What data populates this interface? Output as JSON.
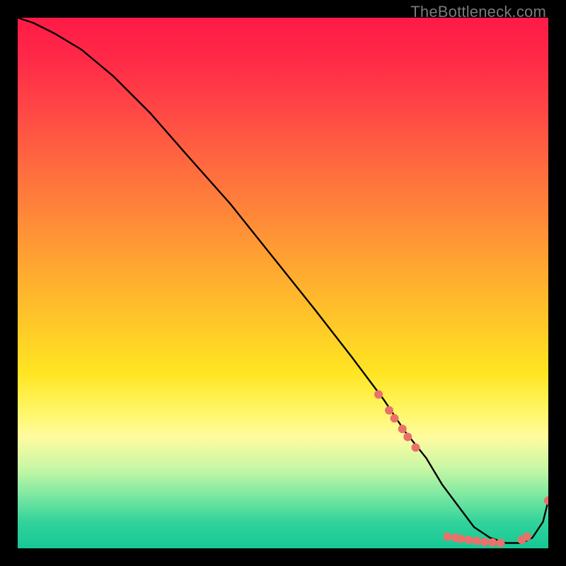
{
  "watermark": "TheBottleneck.com",
  "chart_data": {
    "type": "line",
    "title": "",
    "xlabel": "",
    "ylabel": "",
    "xlim": [
      0,
      100
    ],
    "ylim": [
      0,
      100
    ],
    "grid": false,
    "series": [
      {
        "name": "curve",
        "color": "#000000",
        "x": [
          0,
          3,
          7,
          12,
          18,
          25,
          32,
          40,
          48,
          56,
          63,
          69,
          73,
          77,
          80,
          83,
          86,
          89,
          92,
          95,
          97,
          99,
          100
        ],
        "y": [
          100,
          99,
          97,
          94,
          89,
          82,
          74,
          65,
          55,
          45,
          36,
          28,
          22,
          17,
          12,
          8,
          4,
          2,
          1,
          1,
          2,
          5,
          9
        ]
      }
    ],
    "markers": [
      {
        "name": "dots",
        "color": "#e9716b",
        "radius": 6,
        "points": [
          {
            "x": 68,
            "y": 29
          },
          {
            "x": 70,
            "y": 26
          },
          {
            "x": 71,
            "y": 24.5
          },
          {
            "x": 72.5,
            "y": 22.5
          },
          {
            "x": 73.5,
            "y": 21
          },
          {
            "x": 75,
            "y": 19
          },
          {
            "x": 81,
            "y": 2.2
          },
          {
            "x": 82.5,
            "y": 2.0
          },
          {
            "x": 83.5,
            "y": 1.8
          },
          {
            "x": 85,
            "y": 1.6
          },
          {
            "x": 86.5,
            "y": 1.4
          },
          {
            "x": 88,
            "y": 1.2
          },
          {
            "x": 89.5,
            "y": 1.1
          },
          {
            "x": 91,
            "y": 1.0
          },
          {
            "x": 95,
            "y": 1.6
          },
          {
            "x": 96,
            "y": 2.2
          },
          {
            "x": 100,
            "y": 9
          }
        ]
      }
    ]
  }
}
